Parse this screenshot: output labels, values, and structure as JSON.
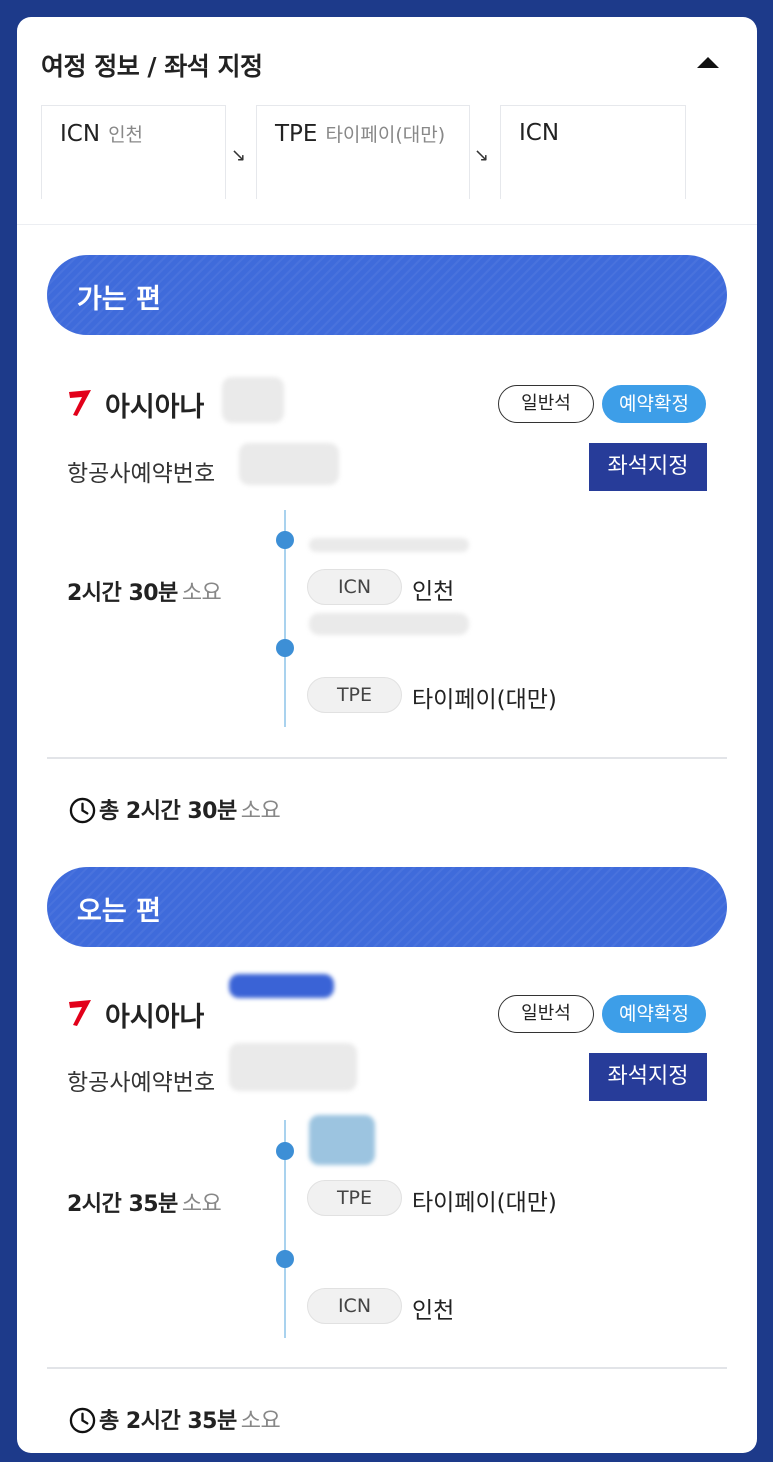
{
  "header": {
    "title": "여정 정보 / 좌석 지정"
  },
  "route": [
    {
      "code": "ICN",
      "city": "인천"
    },
    {
      "code": "TPE",
      "city": "타이페이(대만)"
    },
    {
      "code": "ICN",
      "city": ""
    }
  ],
  "outbound": {
    "banner": "가는 편",
    "airline": "아시아나",
    "seat_class": "일반석",
    "status": "예약확정",
    "pnr_label": "항공사예약번호",
    "seat_button": "좌석지정",
    "duration": "2시간 30분",
    "duration_suffix": "소요",
    "departure": {
      "code": "ICN",
      "name": "인천"
    },
    "arrival": {
      "code": "TPE",
      "name": "타이페이(대만)"
    },
    "total_prefix": "총",
    "total": "2시간 30분",
    "total_suffix": "소요"
  },
  "inbound": {
    "banner": "오는 편",
    "airline": "아시아나",
    "seat_class": "일반석",
    "status": "예약확정",
    "pnr_label": "항공사예약번호",
    "seat_button": "좌석지정",
    "duration": "2시간 35분",
    "duration_suffix": "소요",
    "departure": {
      "code": "TPE",
      "name": "타이페이(대만)"
    },
    "arrival": {
      "code": "ICN",
      "name": "인천"
    },
    "total_prefix": "총",
    "total": "2시간 35분",
    "total_suffix": "소요"
  },
  "colors": {
    "background": "#1d3a8a",
    "banner": "#3f6bdb",
    "status_badge": "#3d9ee8",
    "seat_button": "#273c99",
    "airline_logo": "#e2001a"
  },
  "icons": {
    "collapse": "caret-up-icon",
    "clock": "clock-icon",
    "airline_logo": "asiana-logo-icon"
  }
}
